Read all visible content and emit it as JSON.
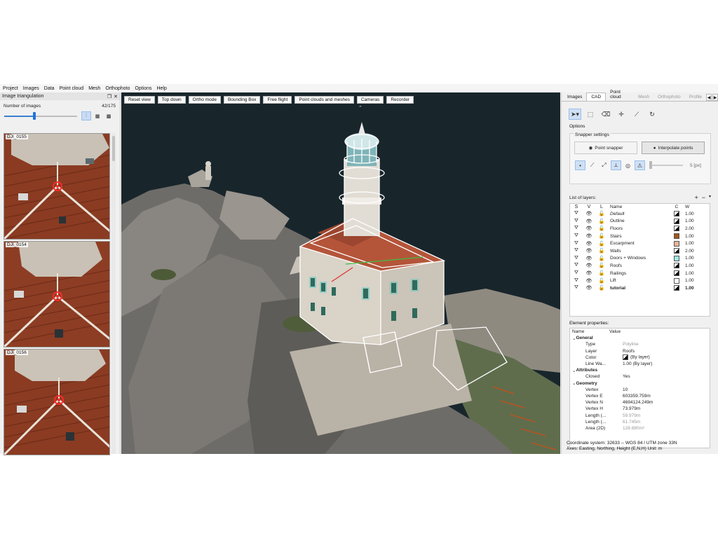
{
  "menu": [
    "Project",
    "Images",
    "Data",
    "Point cloud",
    "Mesh",
    "Orthophoto",
    "Options",
    "Help"
  ],
  "left_panel": {
    "title": "Image triangulation",
    "count_label": "Number of images",
    "count_value": "42/175",
    "slider_fraction": 0.41,
    "thumbnails": [
      "DJI_0155",
      "DJI_0154",
      "DJI_0156"
    ]
  },
  "viewport": {
    "buttons": [
      "Reset view",
      "Top down",
      "Ortho mode",
      "Bounding Box",
      "Free flight",
      "Point clouds and meshes",
      "Cameras",
      "Recorder"
    ]
  },
  "right_panel": {
    "tabs": [
      "Images",
      "CAD",
      "Point cloud",
      "Mesh",
      "Orthophoto",
      "Profile"
    ],
    "active_tab": "CAD",
    "options_label": "Options",
    "snapper_title": "Snapper settings",
    "point_snapper": "Point snapper",
    "interpolate_points": "Interpolate points",
    "snap_distance": "5 [px]",
    "layers_label": "List of layers:",
    "layer_columns": [
      "S",
      "V",
      "L",
      "Name",
      "C",
      "W"
    ],
    "layers": [
      {
        "name": "Default",
        "color": "#ffffff|#000000",
        "w": "1.00",
        "style": "italic"
      },
      {
        "name": "Outline",
        "color": "#ffffff|#000000",
        "w": "1.00",
        "style": ""
      },
      {
        "name": "Floors",
        "color": "#ffffff|#000000",
        "w": "2.00",
        "style": ""
      },
      {
        "name": "Stairs",
        "color": "#a0581a",
        "w": "1.00",
        "style": ""
      },
      {
        "name": "Escarpment",
        "color": "#e8b49a",
        "w": "1.00",
        "style": ""
      },
      {
        "name": "Walls",
        "color": "#ffffff|#000000",
        "w": "2.00",
        "style": ""
      },
      {
        "name": "Doors + Windows",
        "color": "#9fe8e4",
        "w": "1.00",
        "style": ""
      },
      {
        "name": "Roofs",
        "color": "#ffffff|#000000",
        "w": "1.00",
        "style": ""
      },
      {
        "name": "Railings",
        "color": "#ffffff|#000000",
        "w": "1.00",
        "style": ""
      },
      {
        "name": "Lift",
        "color": "#ffffff",
        "w": "1.00",
        "style": ""
      },
      {
        "name": "tutorial",
        "color": "#ffffff|#000000",
        "w": "1.00",
        "style": "bold"
      }
    ],
    "props_label": "Element properties:",
    "props_columns": [
      "Name",
      "Value"
    ],
    "props": [
      {
        "k": "General",
        "v": "",
        "group": true
      },
      {
        "k": "Type",
        "v": "Polyline",
        "muted": true
      },
      {
        "k": "Layer",
        "v": "Roofs"
      },
      {
        "k": "Color",
        "v": "(By layer)",
        "swatch": true
      },
      {
        "k": "Line Wa...",
        "v": "1.00 (By layer)"
      },
      {
        "k": "Attributes",
        "v": "",
        "group": true
      },
      {
        "k": "Closed",
        "v": "Yes"
      },
      {
        "k": "Geometry",
        "v": "",
        "group": true
      },
      {
        "k": "Vertex",
        "v": "10"
      },
      {
        "k": "Vertex E",
        "v": "603359.759m"
      },
      {
        "k": "Vertex N",
        "v": "4694124.249m"
      },
      {
        "k": "Vertex H",
        "v": "73.979m"
      },
      {
        "k": "Length (...",
        "v": "59.979m",
        "muted": true
      },
      {
        "k": "Length (...",
        "v": "61.745m",
        "muted": true
      },
      {
        "k": "Area (2D)",
        "v": "128.880m²",
        "muted": true
      }
    ],
    "coord_line1": "Coordinate system: 32633 -- WGS 84 / UTM zone 33N",
    "coord_line2": "Axes: Easting, Northing, Height (E,N,H) Unit: m"
  }
}
